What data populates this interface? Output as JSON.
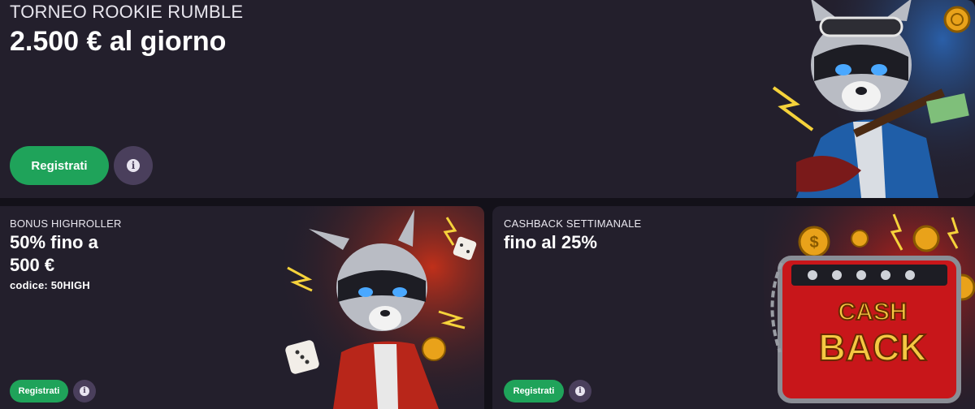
{
  "promos": {
    "top": {
      "kicker": "TORNEO ROOKIE RUMBLE",
      "headline": "2.500 € al giorno",
      "register_label": "Registrati",
      "info_icon": "info-icon",
      "glyph": "i"
    },
    "left": {
      "kicker": "BONUS HIGHROLLER",
      "headline_line1": "50% fino a",
      "headline_line2": "500 €",
      "code": "codice: 50HIGH",
      "register_label": "Registrati",
      "info_icon": "info-icon",
      "glyph": "i"
    },
    "right": {
      "kicker": "CASHBACK SETTIMANALE",
      "headline": "fino al 25%",
      "register_label": "Registrati",
      "info_icon": "info-icon",
      "glyph": "i",
      "art_text_line1": "CASH",
      "art_text_line2": "BACK"
    }
  },
  "colors": {
    "card_bg": "#231f2c",
    "page_bg": "#131119",
    "register_green": "#1fa35a",
    "info_purple": "#4a3f5c"
  }
}
